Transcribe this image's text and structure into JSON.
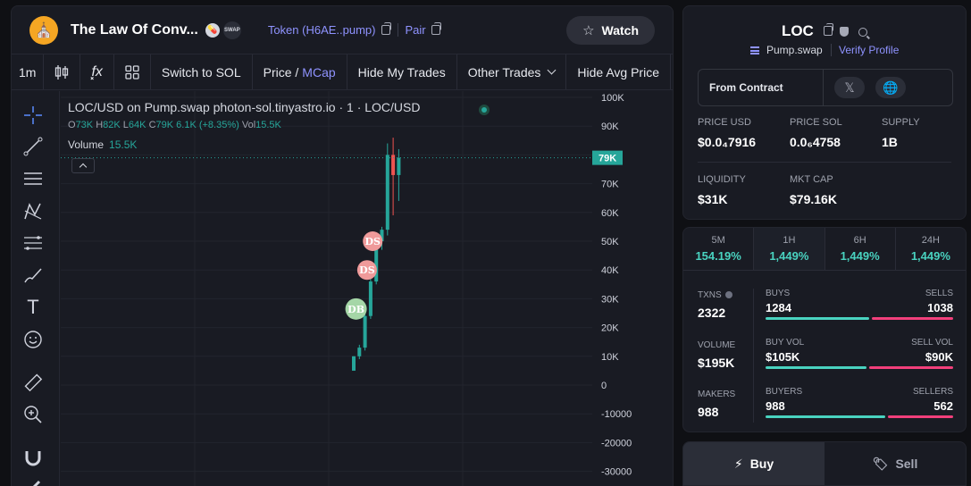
{
  "header": {
    "token_name": "The Law Of Conv...",
    "logo_glyph": "⛪",
    "badge_pill": "💊",
    "badge_swap": "SWAP",
    "token_link": "Token (H6AE..pump)",
    "pair_link": "Pair",
    "watch_label": "Watch"
  },
  "toolbar": {
    "interval": "1m",
    "fx": "f͓x",
    "switch_label": "Switch to SOL",
    "price_label": "Price /",
    "mcap_label": "MCap",
    "hide_trades": "Hide My Trades",
    "other_trades": "Other Trades",
    "hide_avg": "Hide Avg Price"
  },
  "chart": {
    "legend_title": "LOC/USD on Pump.swap photon-sol.tinyastro.io · 1 · LOC/USD",
    "ohlc": {
      "o_label": "O",
      "o": "73K",
      "h_label": "H",
      "h": "82K",
      "l_label": "L",
      "l": "64K",
      "c_label": "C",
      "c": "79K",
      "change": "6.1K (+8.35%)",
      "vol_label": "Vol",
      "vol": "15.5K"
    },
    "volume_label": "Volume",
    "volume_value": "15.5K",
    "current_price_tag": "79K",
    "markers": [
      {
        "label": "DS",
        "color": "#ef9a9a"
      },
      {
        "label": "DS",
        "color": "#ef9a9a"
      },
      {
        "label": "DB",
        "color": "#a5d6a7"
      }
    ]
  },
  "chart_data": {
    "type": "candlestick",
    "title": "LOC/USD on Pump.swap photon-sol.tinyastro.io · 1 · LOC/USD",
    "ylim": [
      -35000,
      105000
    ],
    "y_ticks": [
      100000,
      90000,
      80000,
      70000,
      60000,
      50000,
      40000,
      30000,
      20000,
      10000,
      0,
      -10000,
      -20000,
      -30000
    ],
    "y_tick_labels": [
      "100K",
      "90K",
      "80K",
      "70K",
      "60K",
      "50K",
      "40K",
      "30K",
      "20K",
      "10K",
      "0",
      "-10000",
      "-20000",
      "-30000"
    ],
    "candles": [
      {
        "o": 5000,
        "h": 10000,
        "l": 5000,
        "c": 10000
      },
      {
        "o": 10000,
        "h": 14000,
        "l": 9000,
        "c": 13000
      },
      {
        "o": 13000,
        "h": 25000,
        "l": 12000,
        "c": 24000
      },
      {
        "o": 24000,
        "h": 37000,
        "l": 23000,
        "c": 36000
      },
      {
        "o": 36000,
        "h": 51000,
        "l": 35000,
        "c": 50000
      },
      {
        "o": 50000,
        "h": 55000,
        "l": 47000,
        "c": 54000
      },
      {
        "o": 54000,
        "h": 84000,
        "l": 52000,
        "c": 80000
      },
      {
        "o": 80000,
        "h": 86000,
        "l": 59000,
        "c": 73000
      },
      {
        "o": 73000,
        "h": 82000,
        "l": 64000,
        "c": 79000
      }
    ],
    "up_color": "#26a69a",
    "down_color": "#ef5350"
  },
  "info": {
    "symbol": "LOC",
    "dex": "Pump.swap",
    "verify": "Verify Profile",
    "contract_label": "From Contract",
    "x_glyph": "𝕏",
    "globe_glyph": "🌐",
    "price_usd_label": "PRICE USD",
    "price_usd": "$0.0₄7916",
    "price_sol_label": "PRICE SOL",
    "price_sol": "0.0₆4758",
    "supply_label": "SUPPLY",
    "supply": "1B",
    "liquidity_label": "LIQUIDITY",
    "liquidity": "$31K",
    "mktcap_label": "MKT CAP",
    "mktcap": "$79.16K"
  },
  "stats": {
    "periods": [
      {
        "label": "5M",
        "value": "154.19%"
      },
      {
        "label": "1H",
        "value": "1,449%"
      },
      {
        "label": "6H",
        "value": "1,449%"
      },
      {
        "label": "24H",
        "value": "1,449%"
      }
    ],
    "txns_label": "TXNS",
    "txns": "2322",
    "volume_label": "VOLUME",
    "volume": "$195K",
    "makers_label": "MAKERS",
    "makers": "988",
    "buys_label": "BUYS",
    "buys": "1284",
    "sells_label": "SELLS",
    "sells": "1038",
    "buy_vol_label": "BUY VOL",
    "buy_vol": "$105K",
    "sell_vol_label": "SELL VOL",
    "sell_vol": "$90K",
    "buyers_label": "BUYERS",
    "buyers": "988",
    "sellers_label": "SELLERS",
    "sellers": "562",
    "buy_share": 0.553,
    "buy_vol_share": 0.538,
    "buyer_share": 0.637
  },
  "trade": {
    "buy_label": "Buy",
    "sell_label": "Sell",
    "bolt_glyph": "⚡",
    "tag_glyph": "🏷"
  }
}
